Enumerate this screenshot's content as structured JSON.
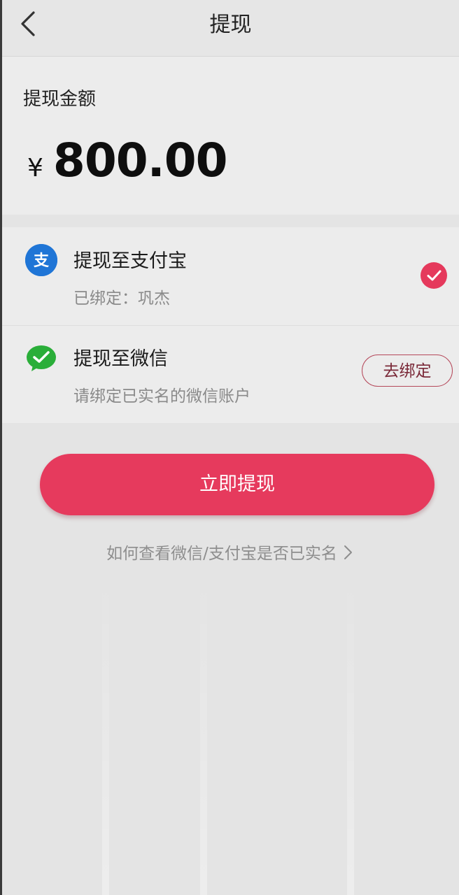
{
  "header": {
    "title": "提现",
    "back_icon": "chevron-left-icon"
  },
  "amount": {
    "label": "提现金额",
    "currency": "¥",
    "value": "800.00"
  },
  "options": [
    {
      "icon": "alipay-icon",
      "title": "提现至支付宝",
      "subtitle": "已绑定：巩杰",
      "selected": true
    },
    {
      "icon": "wechat-icon",
      "title": "提现至微信",
      "subtitle": "请绑定已实名的微信账户",
      "action_label": "去绑定"
    }
  ],
  "submit": {
    "label": "立即提现"
  },
  "help": {
    "label": "如何查看微信/支付宝是否已实名"
  },
  "colors": {
    "accent": "#e63a5d",
    "alipay": "#1f75d6",
    "wechat": "#2aae39",
    "background": "#e4e4e4",
    "card": "#ececec"
  }
}
